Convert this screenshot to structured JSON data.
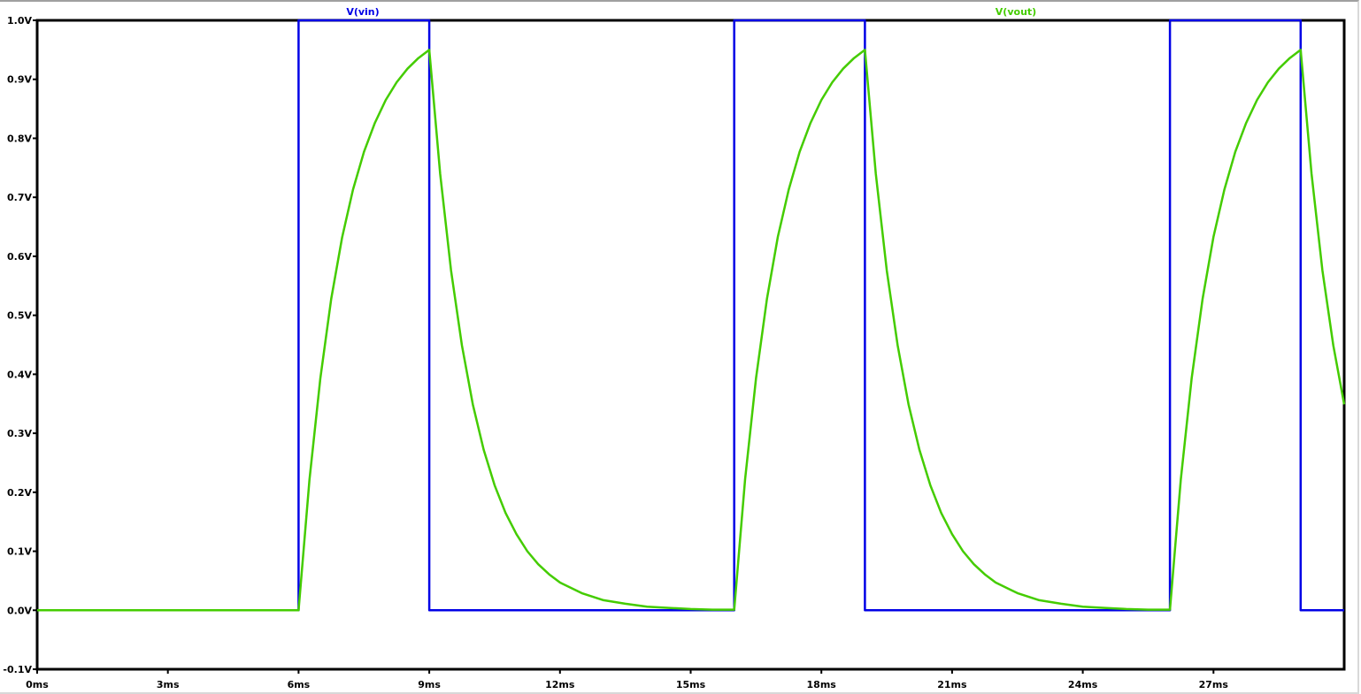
{
  "chart_data": {
    "type": "line",
    "title": "",
    "xlabel": "",
    "ylabel": "",
    "xlim": [
      0,
      30
    ],
    "ylim": [
      -0.1,
      1.0
    ],
    "grid": false,
    "x_ticks": [
      0,
      3,
      6,
      9,
      12,
      15,
      18,
      21,
      24,
      27
    ],
    "x_tick_labels": [
      "0ms",
      "3ms",
      "6ms",
      "9ms",
      "12ms",
      "15ms",
      "18ms",
      "21ms",
      "24ms",
      "27ms"
    ],
    "y_ticks": [
      1.0,
      0.9,
      0.8,
      0.7,
      0.6,
      0.5,
      0.4,
      0.3,
      0.2,
      0.1,
      0.0,
      -0.1
    ],
    "y_tick_labels": [
      "1.0V",
      "0.9V",
      "0.8V",
      "0.7V",
      "0.6V",
      "0.5V",
      "0.4V",
      "0.3V",
      "0.2V",
      "0.1V",
      "0.0V",
      "-0.1V"
    ],
    "series": [
      {
        "name": "V(vin)",
        "color": "#0000e6",
        "x": [
          0,
          6,
          6,
          9,
          9,
          16,
          16,
          19,
          19,
          26,
          26,
          29,
          29,
          30
        ],
        "y": [
          0,
          0,
          1,
          1,
          0,
          0,
          1,
          1,
          0,
          0,
          1,
          1,
          0,
          0
        ]
      },
      {
        "name": "V(vout)",
        "color": "#44cc00",
        "x": [
          0,
          6,
          6.25,
          6.5,
          6.75,
          7,
          7.25,
          7.5,
          7.75,
          8,
          8.25,
          8.5,
          8.75,
          9,
          9.25,
          9.5,
          9.75,
          10,
          10.25,
          10.5,
          10.75,
          11,
          11.25,
          11.5,
          11.75,
          12,
          12.5,
          13,
          13.5,
          14,
          14.5,
          15,
          15.5,
          16,
          16.25,
          16.5,
          16.75,
          17,
          17.25,
          17.5,
          17.75,
          18,
          18.25,
          18.5,
          18.75,
          19,
          19.25,
          19.5,
          19.75,
          20,
          20.25,
          20.5,
          20.75,
          21,
          21.25,
          21.5,
          21.75,
          22,
          22.5,
          23,
          23.5,
          24,
          24.5,
          25,
          25.5,
          26,
          26.25,
          26.5,
          26.75,
          27,
          27.25,
          27.5,
          27.75,
          28,
          28.25,
          28.5,
          28.75,
          29,
          29.25,
          29.5,
          29.75,
          30
        ],
        "y": [
          0,
          0,
          0.221,
          0.393,
          0.528,
          0.632,
          0.713,
          0.777,
          0.826,
          0.865,
          0.895,
          0.918,
          0.936,
          0.95,
          0.74,
          0.576,
          0.449,
          0.349,
          0.272,
          0.212,
          0.165,
          0.129,
          0.1,
          0.078,
          0.061,
          0.047,
          0.029,
          0.017,
          0.011,
          0.006,
          0.004,
          0.002,
          0.001,
          0.001,
          0.222,
          0.394,
          0.528,
          0.633,
          0.713,
          0.777,
          0.826,
          0.865,
          0.895,
          0.918,
          0.936,
          0.95,
          0.74,
          0.576,
          0.449,
          0.349,
          0.272,
          0.212,
          0.165,
          0.129,
          0.1,
          0.078,
          0.061,
          0.047,
          0.029,
          0.017,
          0.011,
          0.006,
          0.004,
          0.002,
          0.001,
          0.001,
          0.222,
          0.394,
          0.528,
          0.633,
          0.713,
          0.777,
          0.826,
          0.865,
          0.895,
          0.918,
          0.936,
          0.95,
          0.74,
          0.576,
          0.449,
          0.349
        ]
      }
    ]
  }
}
